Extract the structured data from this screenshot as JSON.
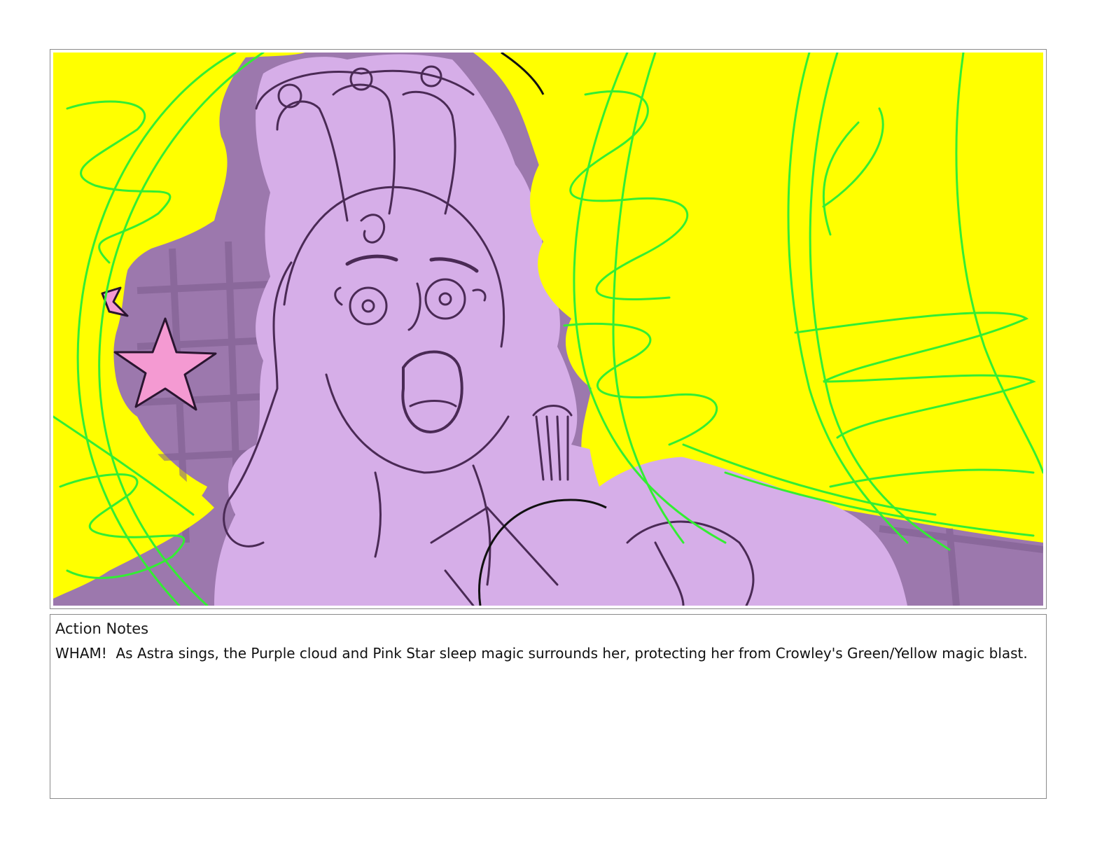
{
  "panel": {
    "description_icon": "storyboard-frame-illustration",
    "colors": {
      "background_yellow": "#ffff00",
      "magic_green": "#33ee33",
      "cloud_purple": "#d6aee8",
      "cloud_shadow": "#9c78ad",
      "star_pink": "#f49ad2",
      "ink": "#4a2a55"
    }
  },
  "notes": {
    "title": "Action Notes",
    "body": "WHAM!  As Astra sings, the Purple cloud and Pink Star sleep magic surrounds her, protecting her from Crowley's Green/Yellow magic blast."
  }
}
